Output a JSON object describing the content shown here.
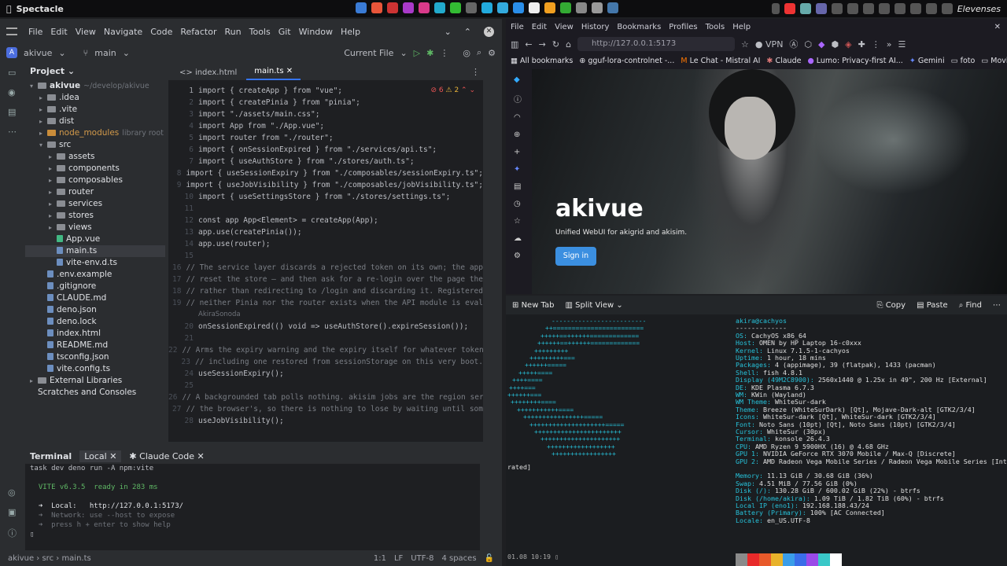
{
  "topbar": {
    "app": "Spectacle",
    "clock": "Elevenses"
  },
  "ide": {
    "menu": [
      "File",
      "Edit",
      "View",
      "Navigate",
      "Code",
      "Refactor",
      "Run",
      "Tools",
      "Git",
      "Window",
      "Help"
    ],
    "project_name": "akivue",
    "project_avatar": "A",
    "branch": "main",
    "run_config": "Current File",
    "project_header": "Project",
    "tree": [
      {
        "indent": 0,
        "kind": "folder",
        "arrow": "▾",
        "name": "akivue",
        "extra": "~/develop/akivue"
      },
      {
        "indent": 1,
        "kind": "folder",
        "arrow": "▸",
        "name": ".idea",
        "extra": ""
      },
      {
        "indent": 1,
        "kind": "folder",
        "arrow": "▸",
        "name": ".vite",
        "extra": ""
      },
      {
        "indent": 1,
        "kind": "folder",
        "arrow": "▸",
        "name": "dist",
        "extra": ""
      },
      {
        "indent": 1,
        "kind": "folder",
        "arrow": "▸",
        "name": "node_modules",
        "extra": "library root"
      },
      {
        "indent": 1,
        "kind": "folder",
        "arrow": "▾",
        "name": "src",
        "extra": ""
      },
      {
        "indent": 2,
        "kind": "folder",
        "arrow": "▸",
        "name": "assets",
        "extra": ""
      },
      {
        "indent": 2,
        "kind": "folder",
        "arrow": "▸",
        "name": "components",
        "extra": ""
      },
      {
        "indent": 2,
        "kind": "folder",
        "arrow": "▸",
        "name": "composables",
        "extra": ""
      },
      {
        "indent": 2,
        "kind": "folder",
        "arrow": "▸",
        "name": "router",
        "extra": ""
      },
      {
        "indent": 2,
        "kind": "folder",
        "arrow": "▸",
        "name": "services",
        "extra": ""
      },
      {
        "indent": 2,
        "kind": "folder",
        "arrow": "▸",
        "name": "stores",
        "extra": ""
      },
      {
        "indent": 2,
        "kind": "folder",
        "arrow": "▸",
        "name": "views",
        "extra": ""
      },
      {
        "indent": 2,
        "kind": "file",
        "arrow": "",
        "name": "App.vue",
        "extra": ""
      },
      {
        "indent": 2,
        "kind": "file",
        "arrow": "",
        "name": "main.ts",
        "extra": "",
        "sel": true
      },
      {
        "indent": 2,
        "kind": "file",
        "arrow": "",
        "name": "vite-env.d.ts",
        "extra": ""
      },
      {
        "indent": 1,
        "kind": "file",
        "arrow": "",
        "name": ".env.example",
        "extra": ""
      },
      {
        "indent": 1,
        "kind": "file",
        "arrow": "",
        "name": ".gitignore",
        "extra": ""
      },
      {
        "indent": 1,
        "kind": "file",
        "arrow": "",
        "name": "CLAUDE.md",
        "extra": ""
      },
      {
        "indent": 1,
        "kind": "file",
        "arrow": "",
        "name": "deno.json",
        "extra": ""
      },
      {
        "indent": 1,
        "kind": "file",
        "arrow": "",
        "name": "deno.lock",
        "extra": ""
      },
      {
        "indent": 1,
        "kind": "file",
        "arrow": "",
        "name": "index.html",
        "extra": ""
      },
      {
        "indent": 1,
        "kind": "file",
        "arrow": "",
        "name": "README.md",
        "extra": ""
      },
      {
        "indent": 1,
        "kind": "file",
        "arrow": "",
        "name": "tsconfig.json",
        "extra": ""
      },
      {
        "indent": 1,
        "kind": "file",
        "arrow": "",
        "name": "vite.config.ts",
        "extra": ""
      },
      {
        "indent": 0,
        "kind": "folder",
        "arrow": "▸",
        "name": "External Libraries",
        "extra": ""
      },
      {
        "indent": 0,
        "kind": "none",
        "arrow": "",
        "name": "Scratches and Consoles",
        "extra": ""
      }
    ],
    "tabs": [
      "index.html",
      "main.ts"
    ],
    "inspections": {
      "errors": "6",
      "warnings": "2"
    },
    "code": [
      {
        "n": "1",
        "t": "import { createApp } from \"vue\";"
      },
      {
        "n": "2",
        "t": "import { createPinia } from \"pinia\";"
      },
      {
        "n": "3",
        "t": "import \"./assets/main.css\";"
      },
      {
        "n": "4",
        "t": "import App from \"./App.vue\";"
      },
      {
        "n": "5",
        "t": "import router from \"./router\";"
      },
      {
        "n": "6",
        "t": "import { onSessionExpired } from \"./services/api.ts\";"
      },
      {
        "n": "7",
        "t": "import { useAuthStore } from \"./stores/auth.ts\";"
      },
      {
        "n": "8",
        "t": "import { useSessionExpiry } from \"./composables/sessionExpiry.ts\";"
      },
      {
        "n": "9",
        "t": "import { useJobVisibility } from \"./composables/jobVisibility.ts\";"
      },
      {
        "n": "10",
        "t": "import { useSettingsStore } from \"./stores/settings.ts\";"
      },
      {
        "n": "11",
        "t": ""
      },
      {
        "n": "12",
        "t": "const app App<Element> = createApp(App);"
      },
      {
        "n": "13",
        "t": "app.use(createPinia());"
      },
      {
        "n": "14",
        "t": "app.use(router);"
      },
      {
        "n": "15",
        "t": ""
      },
      {
        "n": "16",
        "t": "// The service layer discards a rejected token on its own; the app"
      },
      {
        "n": "17",
        "t": "// reset the store — and then ask for a re-login over the page the"
      },
      {
        "n": "18",
        "t": "// rather than redirecting to /login and discarding it. Registered"
      },
      {
        "n": "19",
        "t": "// neither Pinia nor the router exists when the API module is eval"
      },
      {
        "n": "",
        "t": "AkiraSonoda"
      },
      {
        "n": "20",
        "t": "onSessionExpired(() void => useAuthStore().expireSession());"
      },
      {
        "n": "21",
        "t": ""
      },
      {
        "n": "22",
        "t": "// Arms the expiry warning and the expiry itself for whatever token"
      },
      {
        "n": "23",
        "t": "// including one restored from sessionStorage on this very boot."
      },
      {
        "n": "24",
        "t": "useSessionExpiry();"
      },
      {
        "n": "25",
        "t": ""
      },
      {
        "n": "26",
        "t": "// A backgrounded tab polls nothing. akisim jobs are the region ser"
      },
      {
        "n": "27",
        "t": "// the browser's, so there is nothing to lose by waiting until som"
      },
      {
        "n": "28",
        "t": "useJobVisibility();"
      }
    ],
    "terminal": {
      "tabs": [
        "Terminal",
        "Local",
        "Claude Code"
      ],
      "lines": [
        "task dev deno run -A npm:vite",
        "",
        "  VITE v6.3.5  ready in 283 ms",
        "",
        "  ➜  Local:   http://127.0.0.1:5173/",
        "  ➜  Network: use --host to expose",
        "  ➜  press h + enter to show help"
      ]
    },
    "status": {
      "path": [
        "akivue",
        "src",
        "main.ts"
      ],
      "pos": "1:1",
      "eol": "LF",
      "enc": "UTF-8",
      "indent": "4 spaces"
    }
  },
  "browser": {
    "menu": [
      "File",
      "Edit",
      "View",
      "History",
      "Bookmarks",
      "Profiles",
      "Tools",
      "Help"
    ],
    "url": "http://127.0.0.1:5173",
    "vpn": "VPN",
    "bookmarks": [
      "All bookmarks",
      "gguf-lora-controlnet -...",
      "Le Chat - Mistral AI",
      "Claude",
      "Lumo: Privacy-first AI...",
      "Gemini",
      "foto",
      "Movies"
    ],
    "page": {
      "title": "akivue",
      "subtitle": "Unified WebUI for akigrid and akisim.",
      "signin": "Sign in"
    }
  },
  "konsole": {
    "toolbar": {
      "new_tab": "New Tab",
      "split": "Split View",
      "copy": "Copy",
      "paste": "Paste",
      "find": "Find"
    },
    "user": "akira@cachyos",
    "sep": "-------------",
    "info": [
      [
        "OS",
        "CachyOS x86_64"
      ],
      [
        "Host",
        "OMEN by HP Laptop 16-c0xxx"
      ],
      [
        "Kernel",
        "Linux 7.1.5-1-cachyos"
      ],
      [
        "Uptime",
        "1 hour, 18 mins"
      ],
      [
        "Packages",
        "4 (appimage), 39 (flatpak), 1433 (pacman)"
      ],
      [
        "Shell",
        "fish 4.8.1"
      ],
      [
        "Display (49M2C8900)",
        "2560x1440 @ 1.25x in 49\", 200 Hz [External]"
      ],
      [
        "DE",
        "KDE Plasma 6.7.3"
      ],
      [
        "WM",
        "KWin (Wayland)"
      ],
      [
        "WM Theme",
        "WhiteSur-dark"
      ],
      [
        "Theme",
        "Breeze (WhiteSurDark) [Qt], Mojave-Dark-alt [GTK2/3/4]"
      ],
      [
        "Icons",
        "WhiteSur-dark [Qt], WhiteSur-dark [GTK2/3/4]"
      ],
      [
        "Font",
        "Noto Sans (10pt) [Qt], Noto Sans (10pt) [GTK2/3/4]"
      ],
      [
        "Cursor",
        "WhiteSur (30px)"
      ],
      [
        "Terminal",
        "konsole 26.4.3"
      ],
      [
        "CPU",
        "AMD Ryzen 9 5900HX (16) @ 4.68 GHz"
      ],
      [
        "GPU 1",
        "NVIDIA GeForce RTX 3070 Mobile / Max-Q [Discrete]"
      ],
      [
        "GPU 2",
        "AMD Radeon Vega Mobile Series / Radeon Vega Mobile Series [Integ"
      ],
      [
        "",
        ""
      ],
      [
        "Memory",
        "11.13 GiB / 30.68 GiB (36%)"
      ],
      [
        "Swap",
        "4.51 MiB / 77.56 GiB (0%)"
      ],
      [
        "Disk (/)",
        "130.28 GiB / 600.02 GiB (22%) - btrfs"
      ],
      [
        "Disk (/home/akira)",
        "1.09 TiB / 1.82 TiB (60%) - btrfs"
      ],
      [
        "Local IP (eno1)",
        "192.168.188.43/24"
      ],
      [
        "Battery (Primary)",
        "100% [AC Connected]"
      ],
      [
        "Locale",
        "en_US.UTF-8"
      ]
    ],
    "wrap": "rated]",
    "prompt": "01.08 10:19",
    "colors": [
      "#8a8a8a",
      "#e82a2a",
      "#e85a2a",
      "#e8b22a",
      "#3a9de8",
      "#3a6de8",
      "#9a4ae8",
      "#3ac8c8",
      "#ffffff"
    ]
  }
}
